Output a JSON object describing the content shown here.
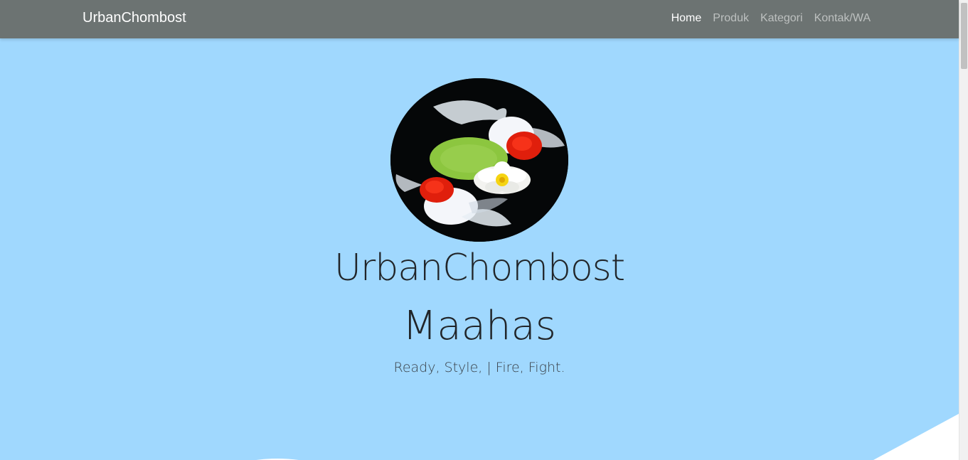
{
  "navbar": {
    "brand": "UrbanChombost",
    "links": [
      {
        "label": "Home",
        "active": true
      },
      {
        "label": "Produk",
        "active": false
      },
      {
        "label": "Kategori",
        "active": false
      },
      {
        "label": "Kontak/WA",
        "active": false
      }
    ]
  },
  "hero": {
    "title_line1": "UrbanChombost",
    "title_line2": "Maahas",
    "tagline": "Ready, Style, | Fire, Fight.",
    "avatar_icon": "koi-fish-lotus-image"
  },
  "colors": {
    "navbar_bg": "#6c7372",
    "hero_bg": "#a0d8fe",
    "text_dark": "#212529",
    "nav_active": "#ffffff"
  }
}
